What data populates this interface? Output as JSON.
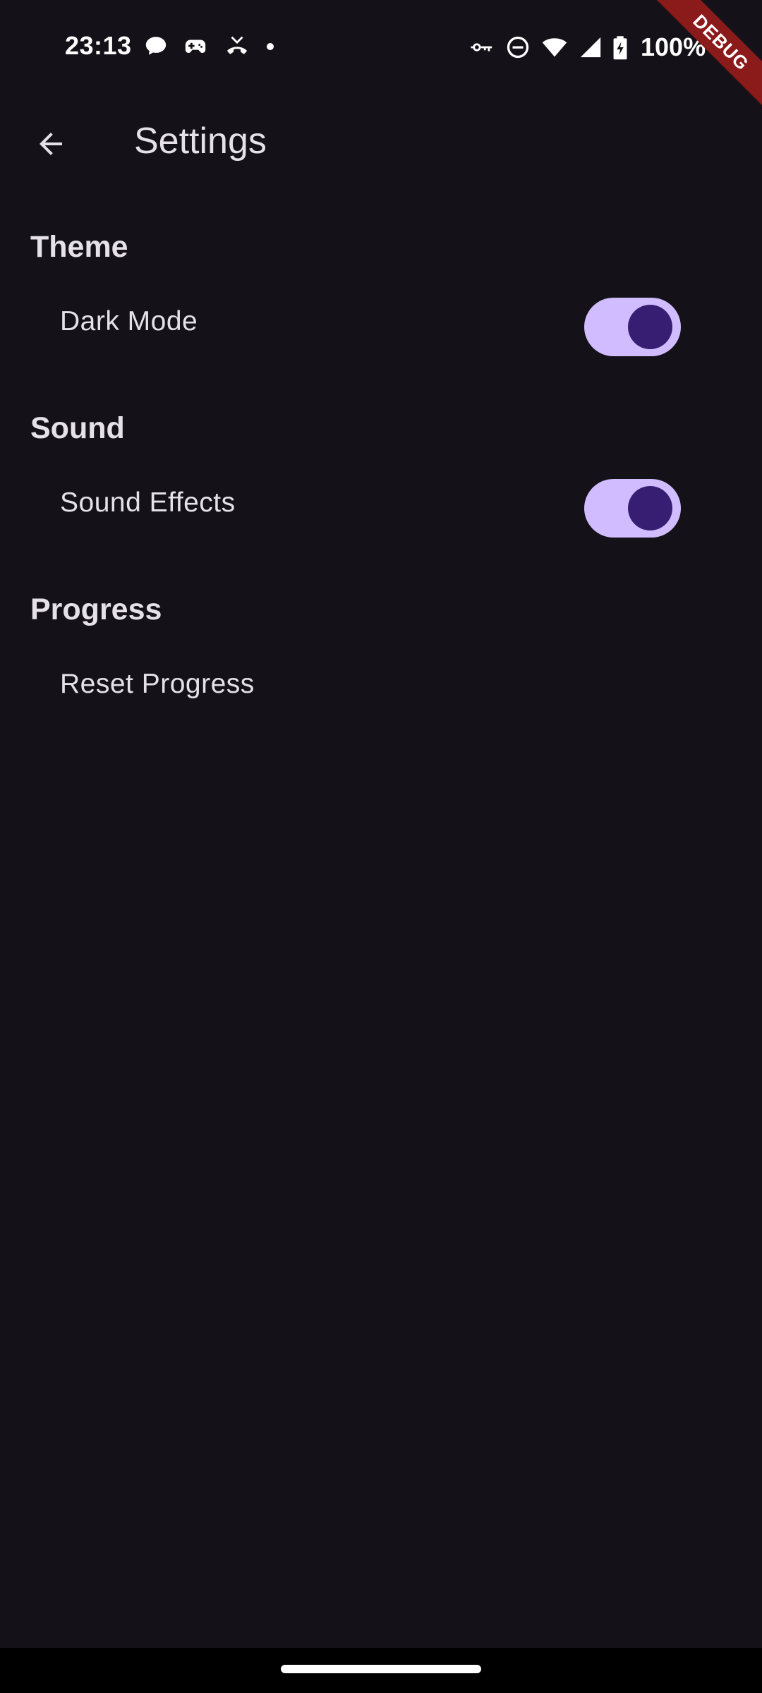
{
  "status_bar": {
    "time": "23:13",
    "battery": "100%",
    "left_icons": [
      "chat-bubble-icon",
      "game-controller-icon",
      "missed-call-icon",
      "dot-icon"
    ],
    "right_icons": [
      "vpn-key-icon",
      "do-not-disturb-icon",
      "wifi-icon",
      "signal-icon",
      "battery-charging-icon"
    ]
  },
  "debug_banner": {
    "label": "DEBUG",
    "color": "#8B1A1A"
  },
  "app_bar": {
    "title": "Settings",
    "back_icon": "arrow-back-icon"
  },
  "sections": [
    {
      "header": "Theme",
      "items": [
        {
          "label": "Dark Mode",
          "type": "switch",
          "value": true
        }
      ]
    },
    {
      "header": "Sound",
      "items": [
        {
          "label": "Sound Effects",
          "type": "switch",
          "value": true
        }
      ]
    },
    {
      "header": "Progress",
      "items": [
        {
          "label": "Reset Progress",
          "type": "action"
        }
      ]
    }
  ],
  "colors": {
    "background": "#141218",
    "on_surface": "#E6E0E9",
    "switch_track": "#D0BCFF",
    "switch_thumb": "#381E72"
  }
}
